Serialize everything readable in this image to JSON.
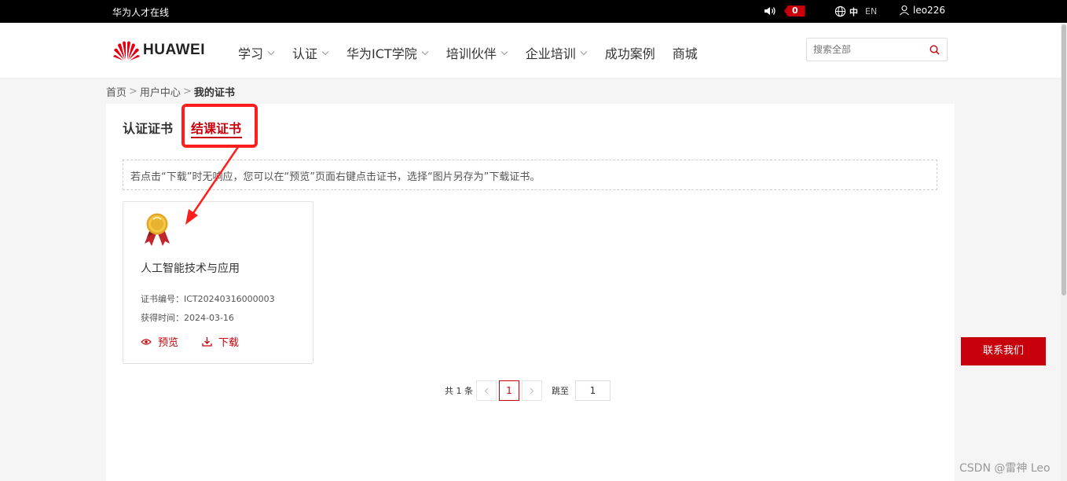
{
  "topbar": {
    "site_name": "华为人才在线",
    "notification_count": "0",
    "lang_zh": "中",
    "lang_en": "EN",
    "username": "leo226"
  },
  "header": {
    "logo_text": "HUAWEI",
    "nav": [
      {
        "label": "学习",
        "has_dropdown": true
      },
      {
        "label": "认证",
        "has_dropdown": true
      },
      {
        "label": "华为ICT学院",
        "has_dropdown": true
      },
      {
        "label": "培训伙伴",
        "has_dropdown": true
      },
      {
        "label": "企业培训",
        "has_dropdown": true
      },
      {
        "label": "成功案例",
        "has_dropdown": false
      },
      {
        "label": "商城",
        "has_dropdown": false
      }
    ],
    "search_placeholder": "搜索全部"
  },
  "breadcrumb": {
    "home": "首页",
    "user_center": "用户中心",
    "current": "我的证书",
    "separator": ">"
  },
  "tabs": {
    "certification": "认证证书",
    "course": "结课证书",
    "active": "结课证书"
  },
  "notice": "若点击“下载”时无响应，您可以在“预览”页面右键点击证书，选择“图片另存为”下载证书。",
  "certificate": {
    "title": "人工智能技术与应用",
    "number_label": "证书编号：",
    "number": "ICT20240316000003",
    "date_label": "获得时间：",
    "date": "2024-03-16",
    "preview_label": "预览",
    "download_label": "下载"
  },
  "pagination": {
    "total_text": "共 1 条",
    "current_page": "1",
    "jump_label": "跳至",
    "jump_value": "1"
  },
  "contact_button": "联系我们",
  "watermark": "CSDN @雷神 Leo",
  "colors": {
    "brand_red": "#c7000b",
    "annotation_red": "#ff1e1e",
    "topbar_bg": "#000000"
  }
}
